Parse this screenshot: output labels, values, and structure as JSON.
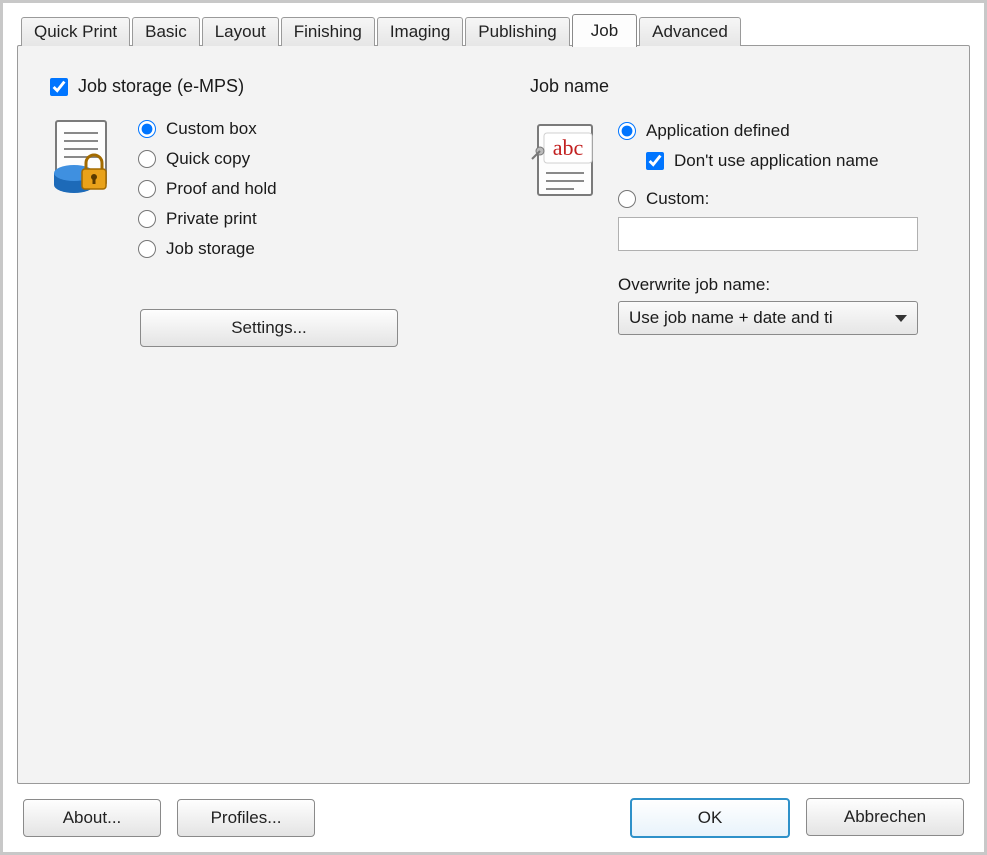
{
  "tabs": {
    "quick_print": "Quick Print",
    "basic": "Basic",
    "layout": "Layout",
    "finishing": "Finishing",
    "imaging": "Imaging",
    "publishing": "Publishing",
    "job": "Job",
    "advanced": "Advanced"
  },
  "job_storage": {
    "checkbox_label": "Job storage (e-MPS)",
    "options": {
      "custom_box": "Custom box",
      "quick_copy": "Quick copy",
      "proof_and_hold": "Proof and hold",
      "private_print": "Private print",
      "job_storage": "Job storage"
    },
    "settings_button": "Settings..."
  },
  "job_name": {
    "title": "Job name",
    "application_defined": "Application defined",
    "dont_use_app_name": "Don't use application name",
    "custom": "Custom:",
    "custom_value": "",
    "overwrite_label": "Overwrite job name:",
    "overwrite_selected": "Use job name + date and ti"
  },
  "buttons": {
    "about": "About...",
    "profiles": "Profiles...",
    "ok": "OK",
    "cancel": "Abbrechen"
  },
  "icons": {
    "job_storage_icon": "document-lock-drive-icon",
    "job_name_icon": "document-abc-icon"
  }
}
